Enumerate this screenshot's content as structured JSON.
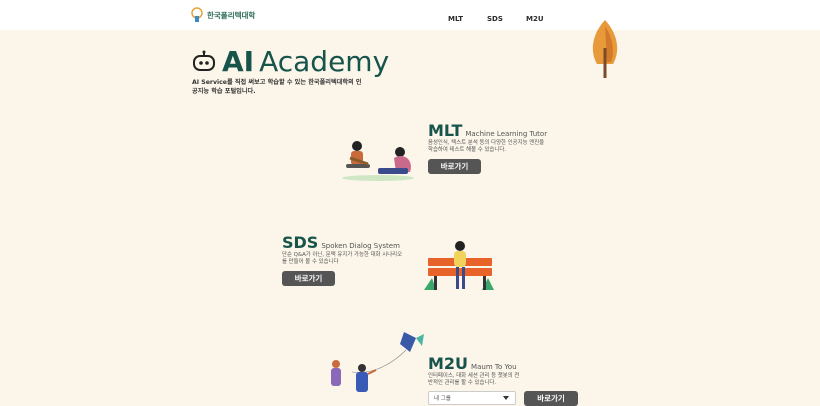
{
  "header": {
    "logo_text": "한국폴리텍대학",
    "nav": [
      {
        "label": "MLT"
      },
      {
        "label": "SDS"
      },
      {
        "label": "M2U"
      }
    ]
  },
  "hero": {
    "title_ai": "AI",
    "title_rest": "Academy",
    "description": "AI Service를 직접 써보고 학습할 수 있는 한국폴리텍대학의 인공지능 학습 포털입니다."
  },
  "sections": {
    "mlt": {
      "code": "MLT",
      "name": "Machine Learning Tutor",
      "description": "음성인식, 텍스트 분석 등의 다양한 인공지능 엔진을 학습하여 테스트 해볼 수 있습니다.",
      "button": "바로가기"
    },
    "sds": {
      "code": "SDS",
      "name": "Spoken Dialog System",
      "description": "단순 Q&A가 아닌, 문맥 유지가 가능한 대화 시나리오를 만들어 볼 수 있습니다",
      "button": "바로가기"
    },
    "m2u": {
      "code": "M2U",
      "name": "Maum To You",
      "description": "인터페이스, 대화 세션 관리 등 챗봇의 전반적인 관리를 할 수 있습니다.",
      "select_value": "내 그룹",
      "button": "바로가기"
    }
  },
  "colors": {
    "background": "#fbf5ea",
    "brand": "#17544a",
    "button": "#555555"
  }
}
